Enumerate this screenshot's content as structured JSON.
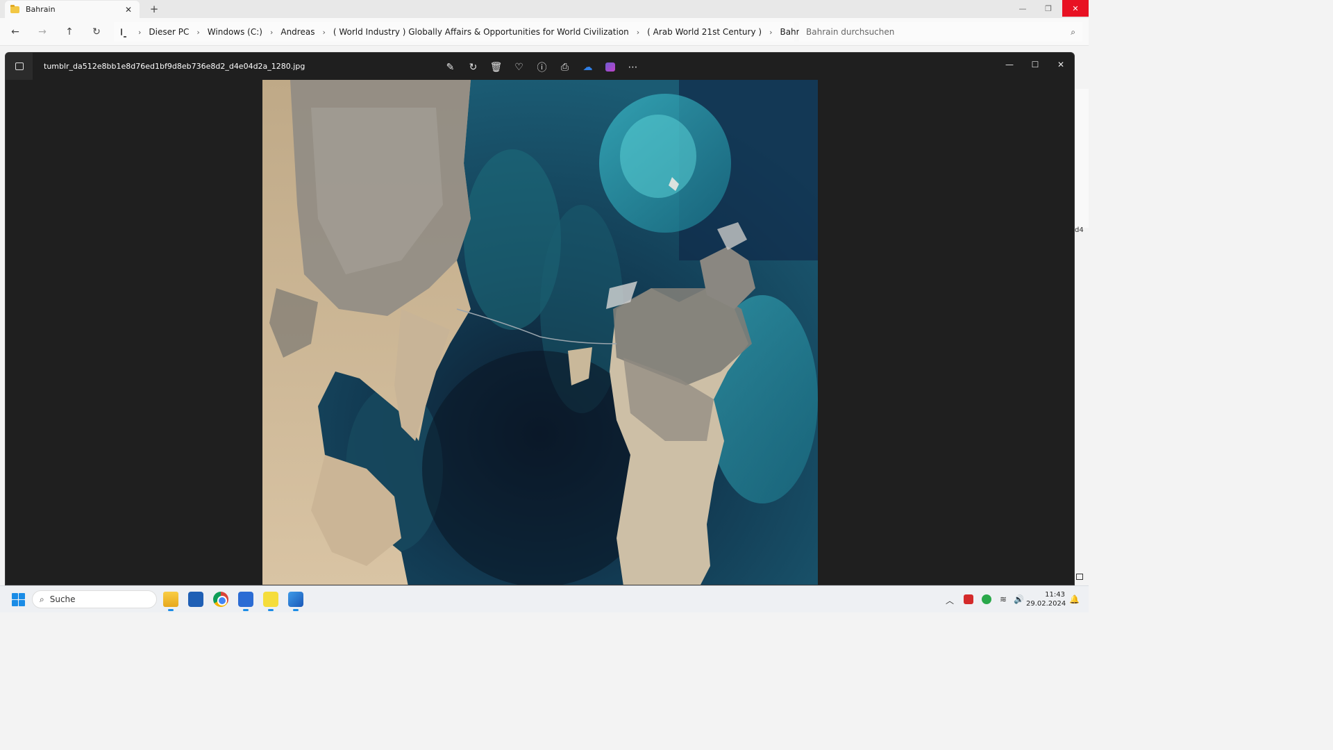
{
  "explorer": {
    "tab_title": "Bahrain",
    "tab_close": "✕",
    "new_tab": "+",
    "window_controls": {
      "minimize": "—",
      "restore": "❐",
      "close": "✕"
    },
    "nav": {
      "back": "←",
      "forward": "→",
      "up": "↑",
      "refresh": "↻"
    },
    "breadcrumbs": [
      "Dieser PC",
      "Windows (C:)",
      "Andreas",
      "( World Industry ) Globally Affairs & Opportunities for World Civilization",
      "( Arab World 21st Century )",
      "Bahrain"
    ],
    "search_placeholder": "Bahrain durchsuchen",
    "side_fragment": "d4"
  },
  "viewer": {
    "filename": "tumblr_da512e8bb1e8d76ed1bf9d8eb736e8d2_d4e04d2a_1280.jpg",
    "toolbar_icons": [
      "edit-icon",
      "rotate-icon",
      "delete-icon",
      "favorite-icon",
      "info-icon",
      "print-icon",
      "onedrive-icon",
      "clipchamp-icon",
      "more-icon"
    ],
    "window_controls": {
      "minimize": "—",
      "maximize": "☐",
      "close": "✕"
    }
  },
  "taskbar": {
    "search_label": "Suche",
    "apps": [
      "file-explorer",
      "microsoft-store",
      "chrome",
      "notepad",
      "sticky-notes",
      "photos"
    ],
    "time": "11:43",
    "date": "29.02.2024"
  },
  "colors": {
    "accent": "#1a8ce6",
    "close_red": "#e81123",
    "viewer_bg": "#1f1f1f"
  }
}
